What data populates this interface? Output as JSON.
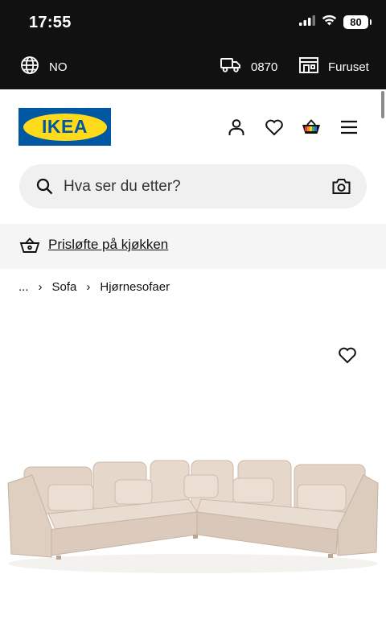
{
  "status_bar": {
    "time": "17:55",
    "battery": "80",
    "icons": [
      "signal-icon",
      "wifi-icon",
      "battery-icon"
    ]
  },
  "top_bar": {
    "language": "NO",
    "delivery_code": "0870",
    "store": "Furuset"
  },
  "header": {
    "logo_text": "IKEA",
    "icons": [
      "account-icon",
      "heart-icon",
      "shopping-bag-icon",
      "menu-icon"
    ]
  },
  "search": {
    "placeholder": "Hva ser du etter?"
  },
  "promo": {
    "label": "Prisløfte på kjøkken"
  },
  "breadcrumb": {
    "ellipsis": "...",
    "items": [
      "Sofa",
      "Hjørnesofaer"
    ]
  },
  "colors": {
    "dark_bar": "#111111",
    "logo_blue": "#0058a3",
    "logo_yellow": "#ffda1a",
    "search_bg": "#f0f0f0",
    "promo_bg": "#f5f5f5"
  }
}
